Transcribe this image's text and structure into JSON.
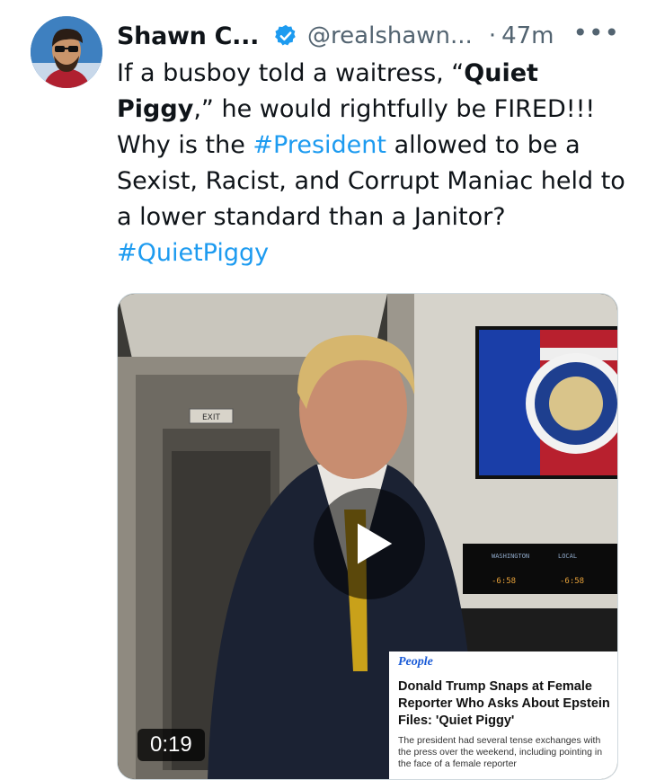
{
  "author": {
    "display_name": "Shawn C...",
    "handle": "@realshawn...",
    "separator": "·",
    "time": "47m",
    "more": "•••",
    "verified_color": "#1d9bf0"
  },
  "tweet": {
    "t1": "If a busboy told a waitress, “",
    "t2": "Quiet Piggy",
    "t3": ",” he would rightfully be FIRED!!! Why is the ",
    "h1": "#President",
    "t4": " allowed to be a Sexist, Racist, and Corrupt Maniac held to a lower standard than a Janitor? ",
    "h2": "#QuietPiggy"
  },
  "media": {
    "duration": "0:19",
    "exit_sign": "EXIT",
    "clock_left_label": "WASHINGTON",
    "clock_right_label": "LOCAL",
    "clock_left_time": "-6:58",
    "clock_right_time": "-6:58",
    "card": {
      "brand": "People",
      "headline": "Donald Trump Snaps at Female Reporter Who Asks About Epstein Files: 'Quiet Piggy'",
      "subtext": "The president had several tense exchanges with the press over the weekend, including pointing in the face of a female reporter"
    }
  },
  "colors": {
    "link": "#1d9bf0",
    "secondary_text": "#536471"
  },
  "icons": {
    "verified": "verified-badge-icon",
    "more": "more-options-icon",
    "play": "play-icon"
  }
}
